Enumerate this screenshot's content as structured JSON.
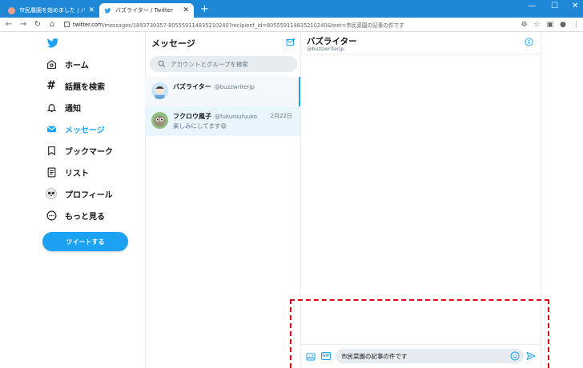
{
  "browser": {
    "tabs": [
      {
        "title": "市民農園を始めました | バズプログ",
        "active": false
      },
      {
        "title": "バズライター / Twitter",
        "active": true
      }
    ],
    "url_host": "twitter.com",
    "url_rest": "/messages/1893730357-805559114835210240?recipient_id=805559114835210240&text=市民菜園の記事の件です"
  },
  "nav": {
    "items": [
      {
        "label": "ホーム",
        "icon": "home-icon"
      },
      {
        "label": "話題を検索",
        "icon": "hashtag-icon"
      },
      {
        "label": "通知",
        "icon": "bell-icon"
      },
      {
        "label": "メッセージ",
        "icon": "mail-icon"
      },
      {
        "label": "ブックマーク",
        "icon": "bookmark-icon"
      },
      {
        "label": "リスト",
        "icon": "list-icon"
      },
      {
        "label": "プロフィール",
        "icon": "avatar-icon"
      },
      {
        "label": "もっと見る",
        "icon": "more-icon"
      }
    ],
    "tweet_button": "ツイートする"
  },
  "messages": {
    "title": "メッセージ",
    "search_placeholder": "アカウントとグループを検索",
    "conversations": [
      {
        "name": "バズライター",
        "handle": "@buzzwriterjp",
        "date": "",
        "preview": ""
      },
      {
        "name": "フクロウ風子",
        "handle": "@fukuroufuuko",
        "date": "2月22日",
        "preview": "楽しみにしてます😄"
      }
    ]
  },
  "chat": {
    "name": "バズライター",
    "handle": "@buzzwriterjp",
    "gif_label": "GIF",
    "input_value": "市民菜園の記事の件です"
  },
  "colors": {
    "accent": "#1da1f2",
    "highlight": "#e60012"
  }
}
